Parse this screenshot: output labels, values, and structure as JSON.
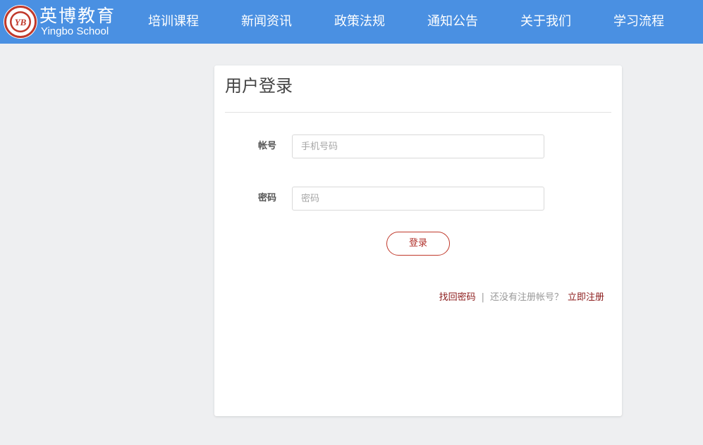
{
  "brand": {
    "name_cn": "英博教育",
    "name_en": "Yingbo School",
    "seal_letters": "YB",
    "seal_color": "#c0392b"
  },
  "nav": {
    "background": "#4a90e2",
    "items": [
      {
        "label": "培训课程"
      },
      {
        "label": "新闻资讯"
      },
      {
        "label": "政策法规"
      },
      {
        "label": "通知公告"
      },
      {
        "label": "关于我们"
      },
      {
        "label": "学习流程"
      }
    ]
  },
  "login": {
    "title": "用户登录",
    "account_label": "帐号",
    "account_placeholder": "手机号码",
    "account_value": "",
    "password_label": "密码",
    "password_placeholder": "密码",
    "password_value": "",
    "submit_label": "登录",
    "forgot_label": "找回密码",
    "separator": "|",
    "no_account_text": "还没有注册帐号？",
    "register_label": "立即注册",
    "accent_color": "#8b1a1a"
  }
}
